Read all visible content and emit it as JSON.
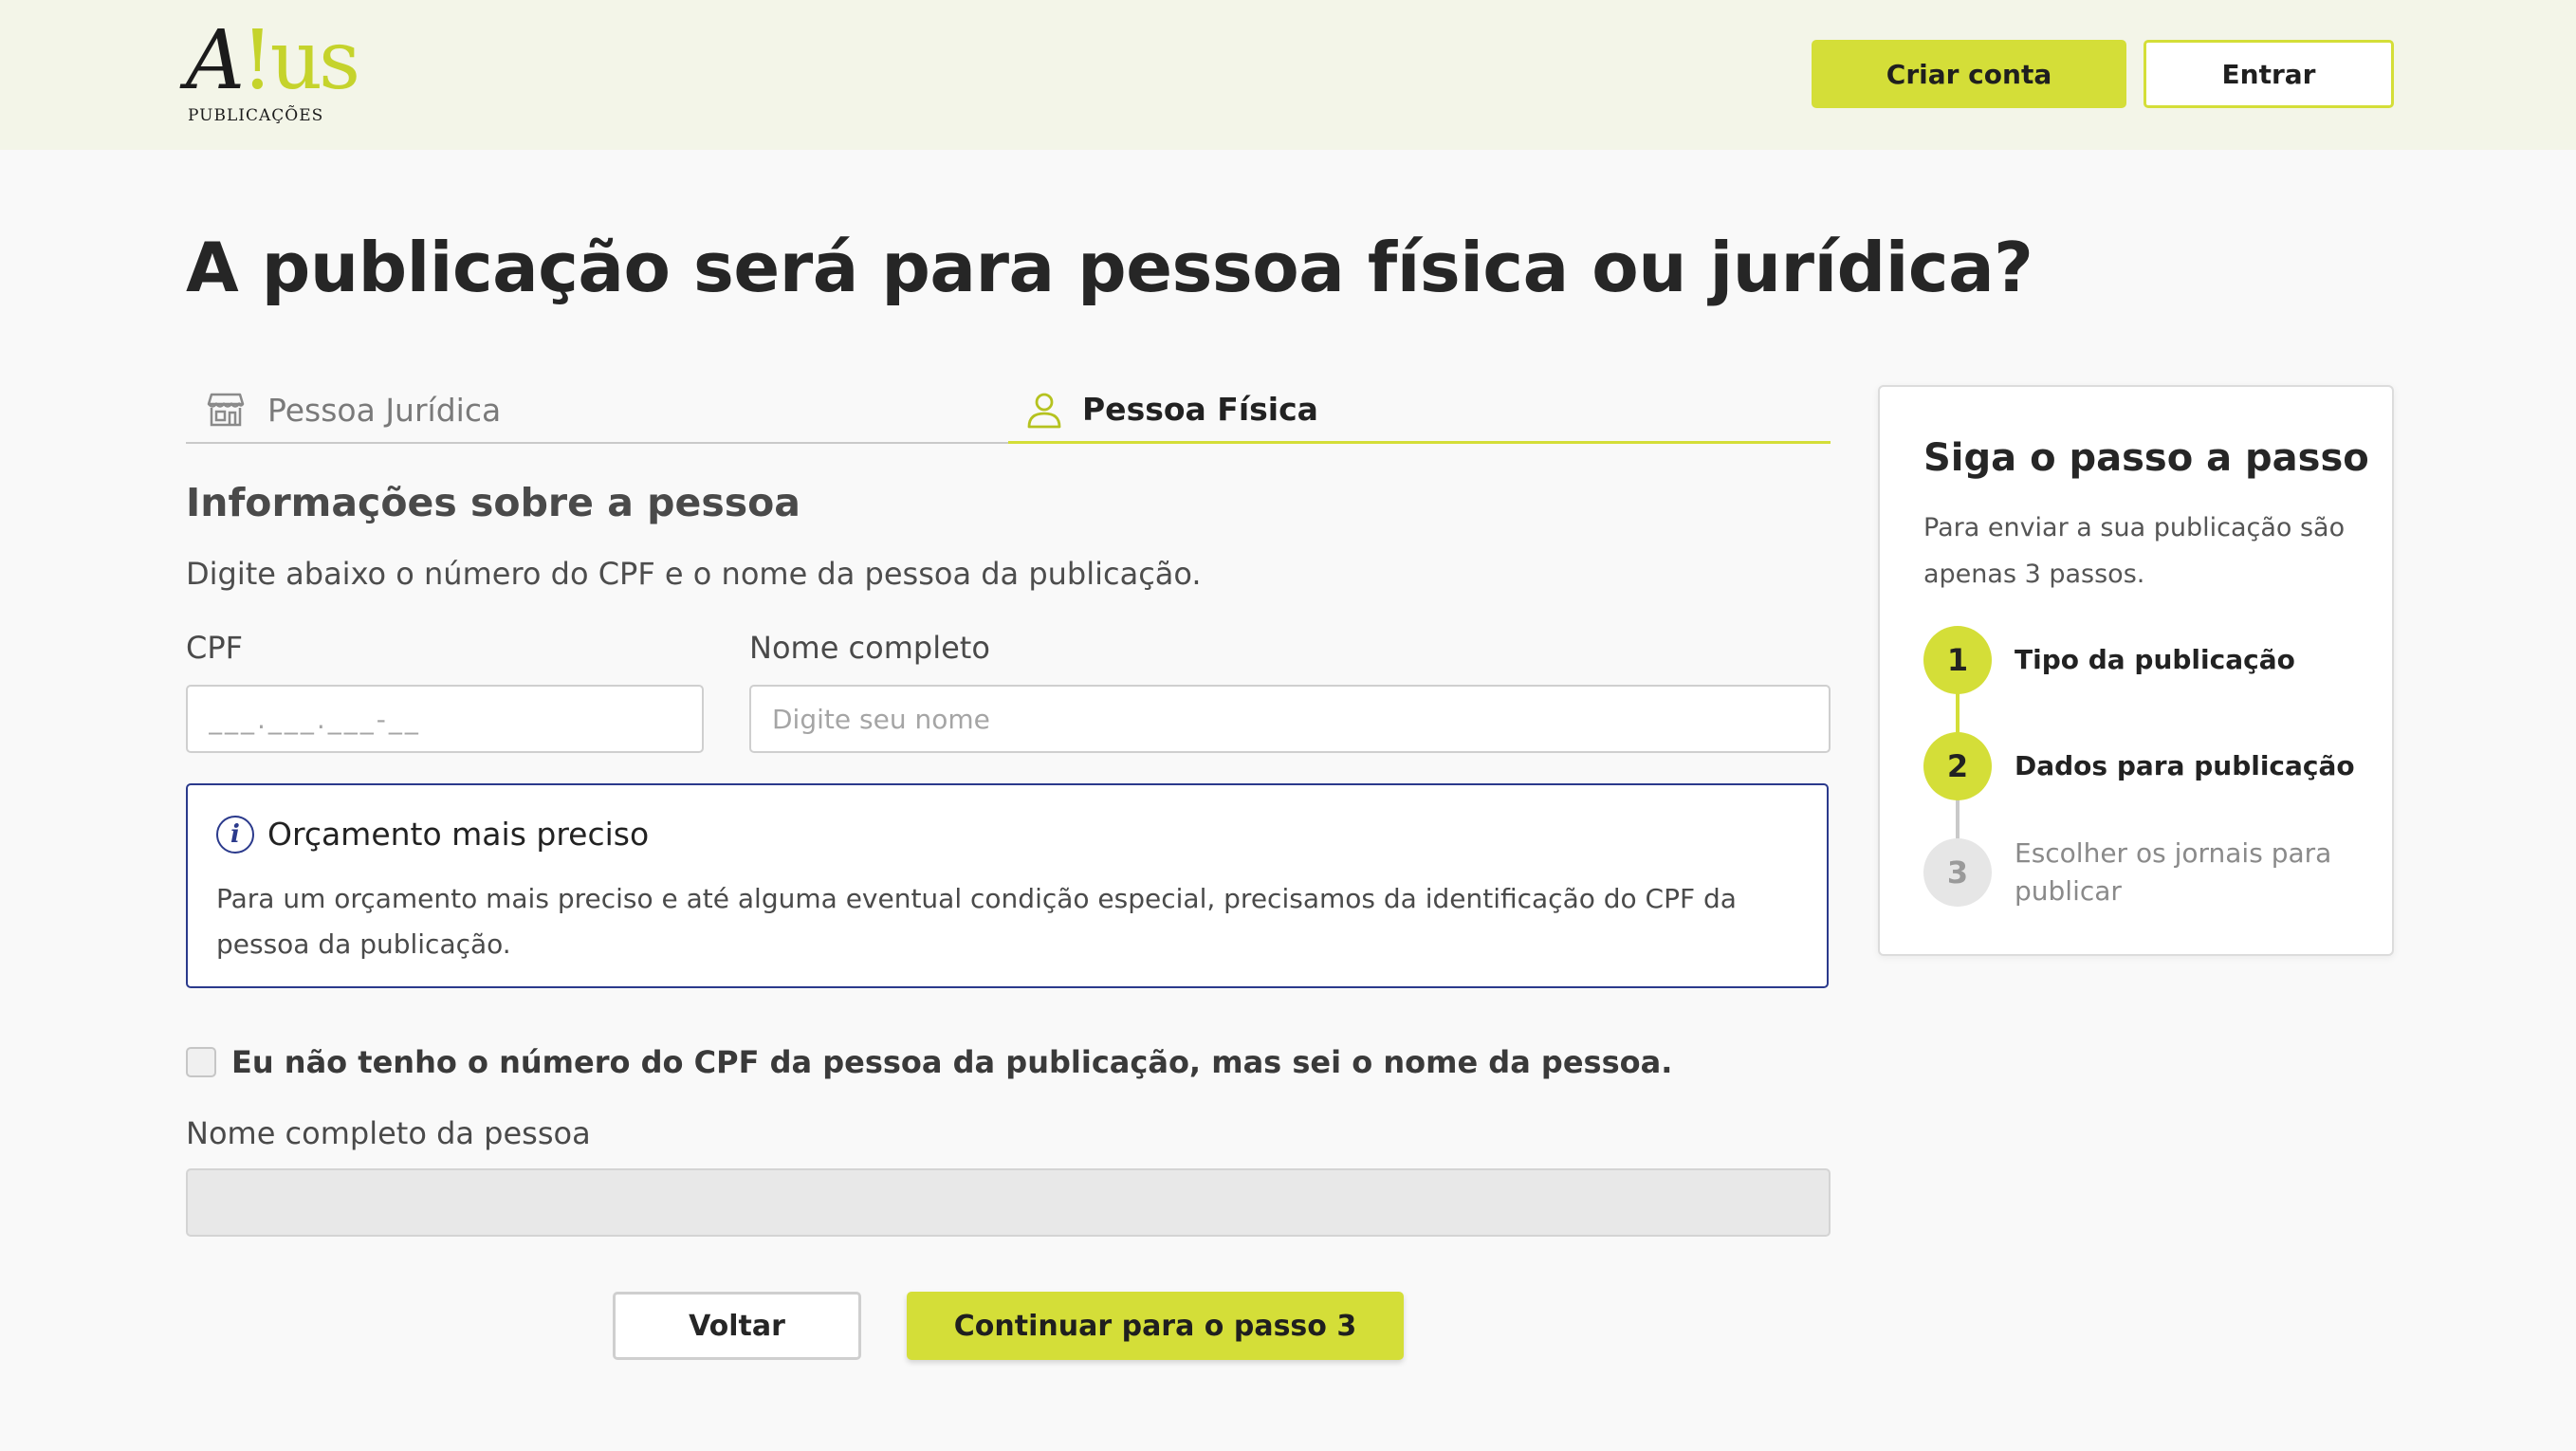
{
  "header": {
    "logo_mark_a": "A",
    "logo_mark_us": "!us",
    "logo_sub": "PUBLICAÇÕES",
    "create_account_label": "Criar conta",
    "login_label": "Entrar"
  },
  "page": {
    "title": "A publicação será para pessoa física ou jurídica?"
  },
  "tabs": [
    {
      "label": "Pessoa Jurídica",
      "icon": "store-icon",
      "active": false
    },
    {
      "label": "Pessoa Física",
      "icon": "person-icon",
      "active": true
    }
  ],
  "form": {
    "section_title": "Informações sobre a pessoa",
    "section_desc": "Digite abaixo o número do CPF e o nome da pessoa da publicação.",
    "cpf_label": "CPF",
    "cpf_placeholder": "___.___.___-__",
    "name_label": "Nome completo",
    "name_placeholder": "Digite seu nome",
    "info_title": "Orçamento mais preciso",
    "info_text": "Para um orçamento mais preciso e até alguma eventual condição especial, precisamos da identificação do CPF da pessoa da publicação.",
    "no_cpf_checkbox_label": "Eu não tenho o número do CPF da pessoa da publicação, mas sei o nome da pessoa.",
    "no_cpf_checked": false,
    "person_name_label": "Nome completo da pessoa",
    "back_label": "Voltar",
    "continue_label": "Continuar para o passo 3"
  },
  "steps_card": {
    "title": "Siga o passo a passo",
    "desc": "Para enviar a sua publicação são apenas 3 passos.",
    "steps": [
      {
        "number": "1",
        "label": "Tipo da publicação",
        "status": "done"
      },
      {
        "number": "2",
        "label": "Dados para publicação",
        "status": "current"
      },
      {
        "number": "3",
        "label": "Escolher os jornais para publicar",
        "status": "pending"
      }
    ]
  },
  "colors": {
    "accent": "#d4de38",
    "header_bg": "#f3f5e8",
    "info_border": "#2b3a8c"
  }
}
